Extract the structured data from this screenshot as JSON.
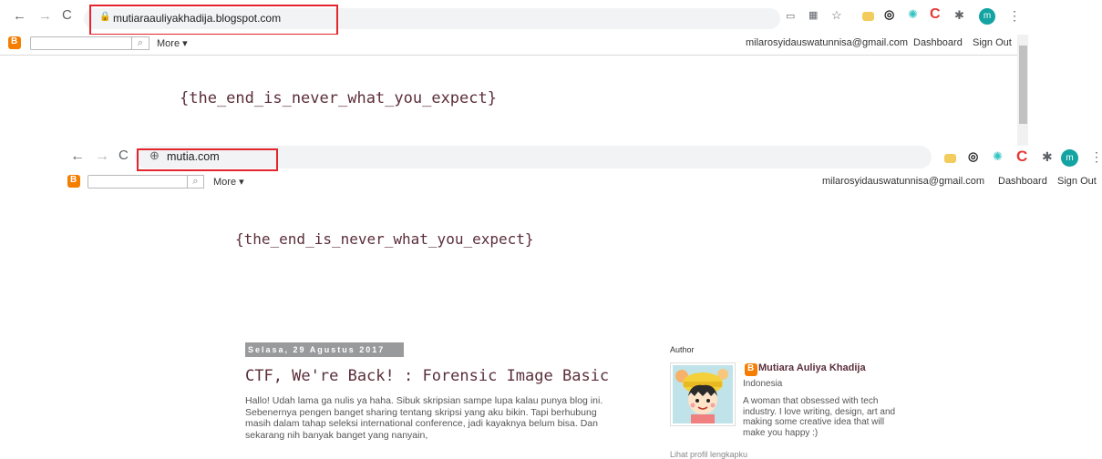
{
  "window1": {
    "url": "mutiaraauliyakhadija.blogspot.com",
    "blogger_nav": {
      "search_placeholder": "",
      "search_btn": "🔍",
      "more_label": "More ▾",
      "email": "milarosyidauswatunnisa@gmail.com",
      "dashboard": "Dashboard",
      "sign_out": "Sign Out"
    },
    "flag": "{the_end_is_never_what_you_expect}"
  },
  "window2": {
    "url": "mutia.com",
    "blogger_nav": {
      "search_placeholder": "",
      "search_btn": "🔍",
      "more_label": "More ▾",
      "email": "milarosyidauswatunnisa@gmail.com",
      "dashboard": "Dashboard",
      "sign_out": "Sign Out"
    },
    "flag": "{the_end_is_never_what_you_expect}",
    "post": {
      "date": "Selasa, 29 Agustus 2017",
      "title": "CTF, We're Back! : Forensic Image Basic",
      "body": [
        "Hallo! Udah lama ga nulis ya haha. Sibuk skripsian sampe lupa kalau punya blog ini.",
        "Sebenernya pengen banget sharing tentang skripsi yang aku bikin. Tapi berhubung",
        "masih dalam tahap seleksi international conference, jadi kayaknya belum bisa. Dan",
        "sekarang nih banyak banget yang nanyain,"
      ]
    },
    "author": {
      "heading": "Author",
      "name": "Mutiara Auliya Khadija",
      "location": "Indonesia",
      "description": "A woman that obsessed with tech industry. I love writing, design, art and making some creative idea that will make you happy :)",
      "profile_link": "Lihat profil lengkapku"
    }
  },
  "colors": {
    "highlight_box": "#e3262d",
    "flag_text": "#5b2e3a",
    "blogger_orange": "#f57d00"
  }
}
